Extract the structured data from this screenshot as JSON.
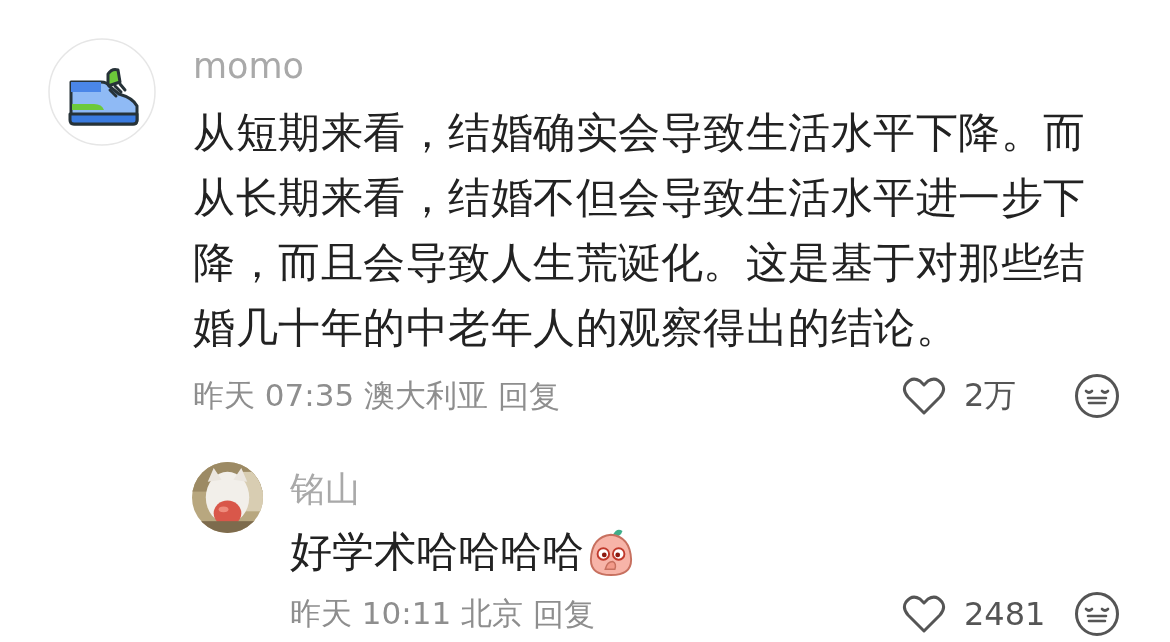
{
  "comment": {
    "author": "momo",
    "text": "从短期来看，结婚确实会导致生活水平下降。而从长期来看，结婚不但会导致生活水平进一步下降，而且会导致人生荒诞化。这是基于对那些结婚几十年的中老年人的观察得出的结论。",
    "time": "昨天 07:35",
    "location": "澳大利亚",
    "reply_label": "回复",
    "likes": "2万"
  },
  "replies": [
    {
      "author": "铭山",
      "text": "好学术哈哈哈哈",
      "time": "昨天 10:11",
      "location": "北京",
      "reply_label": "回复",
      "likes": "2481"
    }
  ]
}
